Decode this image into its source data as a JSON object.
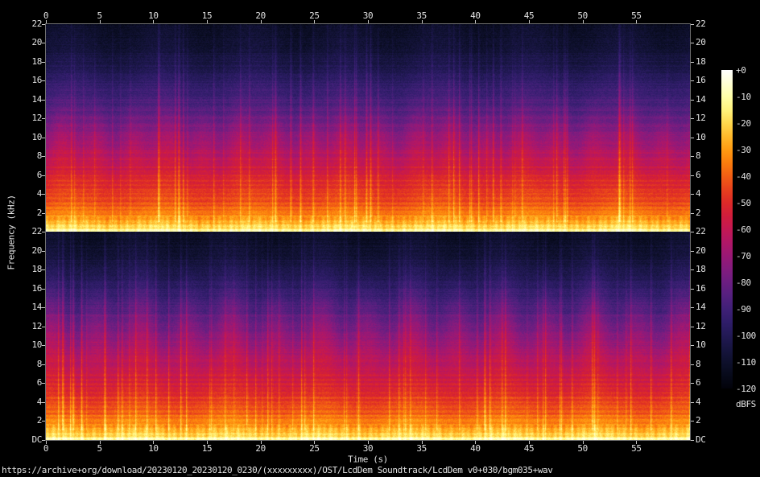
{
  "footer": {
    "url": "https://archive+org/download/20230120_20230120_0230/(xxxxxxxxx)/OST/LcdDem Soundtrack/LcdDem v0+030/bgm035+wav"
  },
  "chart_data": {
    "type": "heatmap",
    "subtype": "stereo audio spectrogram, two channels stacked vertically",
    "x": {
      "label": "Time (s)",
      "min": 0,
      "max": 60,
      "ticks": [
        0,
        5,
        10,
        15,
        20,
        25,
        30,
        35,
        40,
        45,
        50,
        55
      ]
    },
    "y": {
      "label": "Frequency (kHz)",
      "min_label": "DC",
      "max": 22,
      "tick_step": 2,
      "ticks_top_panel": [
        "22",
        "20",
        "18",
        "16",
        "14",
        "12",
        "10",
        "8",
        "6",
        "4",
        "2"
      ],
      "ticks_bottom_panel": [
        "22",
        "20",
        "18",
        "16",
        "14",
        "12",
        "10",
        "8",
        "6",
        "4",
        "2",
        "DC"
      ]
    },
    "colorbar": {
      "unit": "dBFS",
      "min": -120,
      "max": 0,
      "tick_labels": [
        "+0",
        "-10",
        "-20",
        "-30",
        "-40",
        "-50",
        "-60",
        "-70",
        "-80",
        "-90",
        "-100",
        "-110",
        "-120"
      ],
      "tick_values": [
        0,
        -10,
        -20,
        -30,
        -40,
        -50,
        -60,
        -70,
        -80,
        -90,
        -100,
        -110,
        -120
      ],
      "palette": [
        [
          0,
          "#ffffff"
        ],
        [
          -5,
          "#ffffd5"
        ],
        [
          -10,
          "#ffffa8"
        ],
        [
          -15,
          "#fff37d"
        ],
        [
          -20,
          "#ffd84e"
        ],
        [
          -25,
          "#ffb92b"
        ],
        [
          -30,
          "#ff9b12"
        ],
        [
          -35,
          "#fb7d0d"
        ],
        [
          -40,
          "#f25e14"
        ],
        [
          -45,
          "#e8411d"
        ],
        [
          -50,
          "#dd2a28"
        ],
        [
          -55,
          "#d11d3c"
        ],
        [
          -60,
          "#c31853"
        ],
        [
          -65,
          "#b01767"
        ],
        [
          -70,
          "#9a1875"
        ],
        [
          -75,
          "#831c7e"
        ],
        [
          -80,
          "#6b1e81"
        ],
        [
          -85,
          "#55207f"
        ],
        [
          -90,
          "#402077"
        ],
        [
          -95,
          "#2f1d69"
        ],
        [
          -100,
          "#221955"
        ],
        [
          -105,
          "#171540"
        ],
        [
          -110,
          "#0e102c"
        ],
        [
          -115,
          "#070a1a"
        ],
        [
          -120,
          "#02020a"
        ]
      ]
    },
    "channels": [
      {
        "name": "channel-1-top",
        "avg_spectrum_db_by_khz": [
          [
            0,
            -13
          ],
          [
            0.3,
            -17
          ],
          [
            0.8,
            -24
          ],
          [
            1.5,
            -31
          ],
          [
            2,
            -36
          ],
          [
            3,
            -42
          ],
          [
            4,
            -46
          ],
          [
            5,
            -50
          ],
          [
            6,
            -54
          ],
          [
            7,
            -58
          ],
          [
            8,
            -62
          ],
          [
            9,
            -66
          ],
          [
            10,
            -70
          ],
          [
            11,
            -75
          ],
          [
            12,
            -79
          ],
          [
            13,
            -84
          ],
          [
            14,
            -88
          ],
          [
            15,
            -92
          ],
          [
            16,
            -96
          ],
          [
            17,
            -100
          ],
          [
            18,
            -103
          ],
          [
            19,
            -106
          ],
          [
            20,
            -108
          ],
          [
            21,
            -110
          ],
          [
            22,
            -112
          ]
        ]
      },
      {
        "name": "channel-2-bottom",
        "avg_spectrum_db_by_khz": [
          [
            0,
            -13
          ],
          [
            0.3,
            -17
          ],
          [
            0.8,
            -24
          ],
          [
            1.5,
            -31
          ],
          [
            2,
            -35
          ],
          [
            3,
            -41
          ],
          [
            4,
            -45
          ],
          [
            5,
            -50
          ],
          [
            6,
            -54
          ],
          [
            7,
            -58
          ],
          [
            8,
            -61
          ],
          [
            9,
            -64
          ],
          [
            10,
            -68
          ],
          [
            11,
            -72
          ],
          [
            12,
            -76
          ],
          [
            13,
            -81
          ],
          [
            14,
            -85
          ],
          [
            15,
            -90
          ],
          [
            16,
            -94
          ],
          [
            17,
            -98
          ],
          [
            18,
            -102
          ],
          [
            19,
            -105
          ],
          [
            20,
            -108
          ],
          [
            21,
            -110
          ],
          [
            22,
            -112
          ]
        ]
      }
    ],
    "texture": {
      "seeds": [
        1337,
        7331
      ],
      "onset_density": 0.085,
      "pixel_noise_db": 3.4,
      "swell_db": 2.2,
      "swell_cycles": 7
    }
  },
  "colors": {
    "background": "#000000",
    "text": "#e2e2e2",
    "frame": "#6f6f6f",
    "tick": "#c9c9c9"
  }
}
